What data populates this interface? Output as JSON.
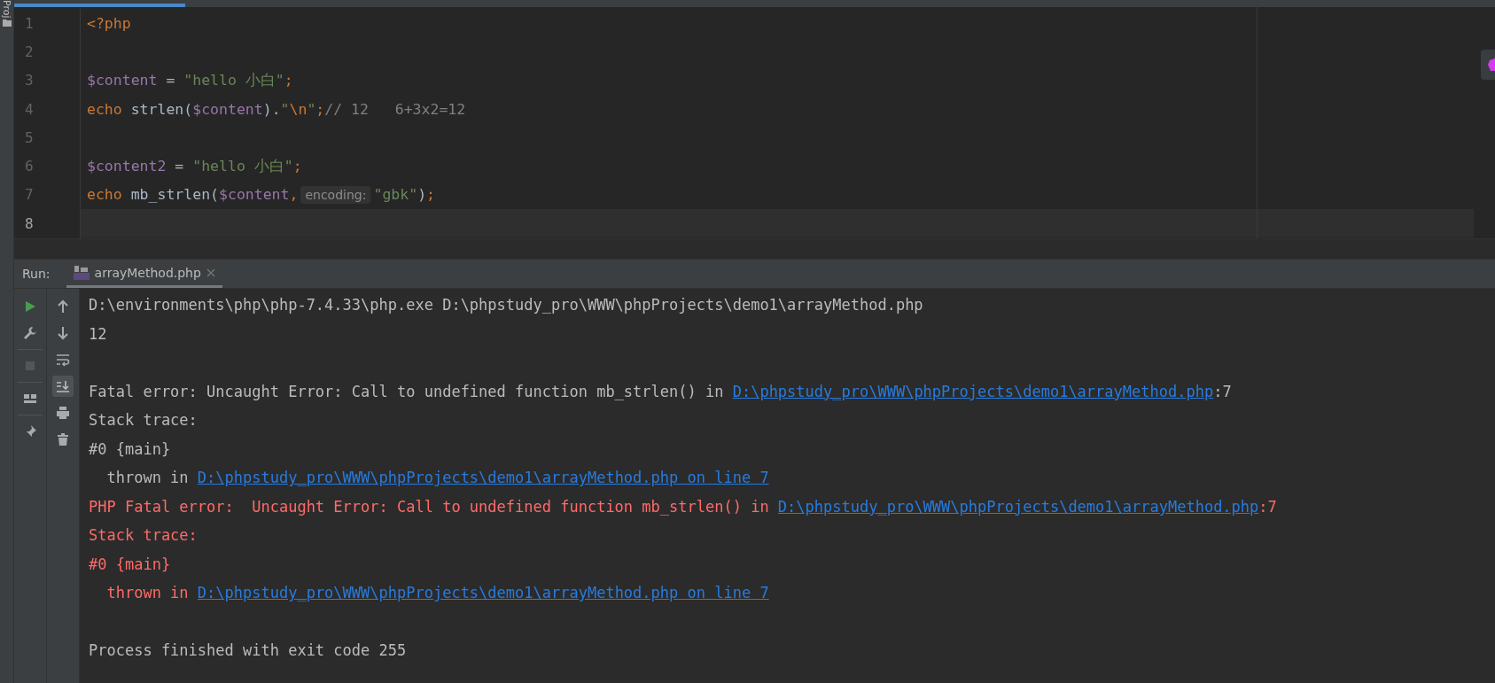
{
  "project_strip": {
    "label": "Proj"
  },
  "editor": {
    "lines": [
      {
        "number": "1",
        "current": false,
        "tokens": [
          {
            "kind": "keyword",
            "text": "<?php"
          }
        ]
      },
      {
        "number": "2",
        "current": false
      },
      {
        "number": "3",
        "current": false,
        "tokens": [
          {
            "kind": "var",
            "text": "$content"
          },
          {
            "kind": "plain",
            "text": " = "
          },
          {
            "kind": "string",
            "text": "\"hello 小白\""
          },
          {
            "kind": "keyword",
            "text": ";"
          }
        ]
      },
      {
        "number": "4",
        "current": false,
        "tokens": [
          {
            "kind": "keyword",
            "text": "echo "
          },
          {
            "kind": "plain",
            "text": "strlen("
          },
          {
            "kind": "var",
            "text": "$content"
          },
          {
            "kind": "plain",
            "text": ")."
          },
          {
            "kind": "string",
            "text": "\""
          },
          {
            "kind": "keyword",
            "text": "\\n"
          },
          {
            "kind": "string",
            "text": "\""
          },
          {
            "kind": "keyword",
            "text": ";"
          },
          {
            "kind": "comment",
            "text": "// 12   6+3x2=12"
          }
        ]
      },
      {
        "number": "5",
        "current": false
      },
      {
        "number": "6",
        "current": false,
        "tokens": [
          {
            "kind": "var",
            "text": "$content2"
          },
          {
            "kind": "plain",
            "text": " = "
          },
          {
            "kind": "string",
            "text": "\"hello 小白\""
          },
          {
            "kind": "keyword",
            "text": ";"
          }
        ]
      },
      {
        "number": "7",
        "current": false,
        "tokens": [
          {
            "kind": "keyword",
            "text": "echo "
          },
          {
            "kind": "plain",
            "text": "mb_strlen("
          },
          {
            "kind": "var",
            "text": "$content"
          },
          {
            "kind": "keyword",
            "text": ","
          },
          {
            "kind": "hint",
            "text": "encoding:"
          },
          {
            "kind": "string",
            "text": "\"gbk\""
          },
          {
            "kind": "plain",
            "text": ")"
          },
          {
            "kind": "keyword",
            "text": ";"
          }
        ]
      },
      {
        "number": "8",
        "current": true
      }
    ]
  },
  "run_panel": {
    "label": "Run:",
    "tab": {
      "title": "arrayMethod.php",
      "selected": true
    },
    "scroll_to_end_active": true,
    "console": [
      {
        "kind": "text",
        "segments": [
          {
            "kind": "normal",
            "text": "D:\\environments\\php\\php-7.4.33\\php.exe D:\\phpstudy_pro\\WWW\\phpProjects\\demo1\\arrayMethod.php"
          }
        ]
      },
      {
        "kind": "text",
        "segments": [
          {
            "kind": "normal",
            "text": "12"
          }
        ]
      },
      {
        "kind": "blank"
      },
      {
        "kind": "text",
        "segments": [
          {
            "kind": "normal",
            "text": "Fatal error: Uncaught Error: Call to undefined function mb_strlen() in "
          },
          {
            "kind": "link",
            "text": "D:\\phpstudy_pro\\WWW\\phpProjects\\demo1\\arrayMethod.php"
          },
          {
            "kind": "normal",
            "text": ":7"
          }
        ]
      },
      {
        "kind": "text",
        "segments": [
          {
            "kind": "normal",
            "text": "Stack trace:"
          }
        ]
      },
      {
        "kind": "text",
        "segments": [
          {
            "kind": "normal",
            "text": "#0 {main}"
          }
        ]
      },
      {
        "kind": "text",
        "segments": [
          {
            "kind": "normal",
            "text": "  thrown in "
          },
          {
            "kind": "link",
            "text": "D:\\phpstudy_pro\\WWW\\phpProjects\\demo1\\arrayMethod.php on line 7"
          }
        ]
      },
      {
        "kind": "text",
        "segments": [
          {
            "kind": "error",
            "text": "PHP Fatal error:  Uncaught Error: Call to undefined function mb_strlen() in "
          },
          {
            "kind": "link",
            "text": "D:\\phpstudy_pro\\WWW\\phpProjects\\demo1\\arrayMethod.php"
          },
          {
            "kind": "error",
            "text": ":7"
          }
        ]
      },
      {
        "kind": "text",
        "segments": [
          {
            "kind": "error",
            "text": "Stack trace:"
          }
        ]
      },
      {
        "kind": "text",
        "segments": [
          {
            "kind": "error",
            "text": "#0 {main}"
          }
        ]
      },
      {
        "kind": "text",
        "segments": [
          {
            "kind": "error",
            "text": "  thrown in "
          },
          {
            "kind": "link",
            "text": "D:\\phpstudy_pro\\WWW\\phpProjects\\demo1\\arrayMethod.php on line 7"
          }
        ]
      },
      {
        "kind": "blank"
      },
      {
        "kind": "text",
        "segments": [
          {
            "kind": "normal",
            "text": "Process finished with exit code 255"
          }
        ]
      }
    ]
  }
}
